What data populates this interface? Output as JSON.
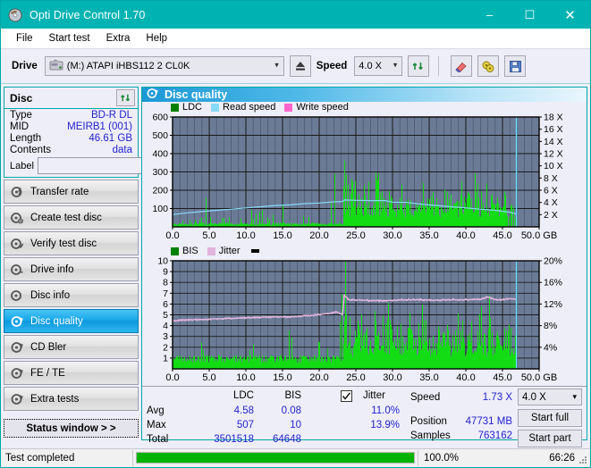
{
  "window": {
    "title": "Opti Drive Control 1.70",
    "icon": "disc-icon",
    "minimize": "–",
    "maximize": "☐",
    "close": "✕"
  },
  "menu": {
    "items": [
      {
        "label": "File",
        "accel": "F"
      },
      {
        "label": "Start test",
        "accel": "S"
      },
      {
        "label": "Extra",
        "accel": "x"
      },
      {
        "label": "Help",
        "accel": "H"
      }
    ]
  },
  "toolbar": {
    "drive_label": "Drive",
    "drive_value": "(M:)   ATAPI iHBS112  2 CL0K",
    "drive_icon": "drive-icon",
    "eject_icon": "eject-icon",
    "speed_label": "Speed",
    "speed_value": "4.0 X",
    "refresh_icon": "refresh-icon",
    "erase_icon": "eraser-icon",
    "bitsetting_icon": "bitsetting-icon",
    "save_icon": "save-icon"
  },
  "disc_panel": {
    "title": "Disc",
    "refresh_icon": "refresh-icon",
    "rows": [
      {
        "key": "Type",
        "value": "BD-R DL"
      },
      {
        "key": "MID",
        "value": "MEIRB1 (001)"
      },
      {
        "key": "Length",
        "value": "46.61 GB"
      },
      {
        "key": "Contents",
        "value": "data"
      }
    ],
    "label_key": "Label",
    "label_value": "",
    "label_placeholder": "",
    "label_icon": "disc-label-icon"
  },
  "sidebar": {
    "items": [
      {
        "label": "Transfer rate",
        "icon": "disc-transfer-icon",
        "active": false
      },
      {
        "label": "Create test disc",
        "icon": "disc-create-icon",
        "active": false
      },
      {
        "label": "Verify test disc",
        "icon": "disc-verify-icon",
        "active": false
      },
      {
        "label": "Drive info",
        "icon": "drive-info-icon",
        "active": false
      },
      {
        "label": "Disc info",
        "icon": "disc-info-icon",
        "active": false
      },
      {
        "label": "Disc quality",
        "icon": "disc-quality-icon",
        "active": true
      },
      {
        "label": "CD Bler",
        "icon": "cd-bler-icon",
        "active": false
      },
      {
        "label": "FE / TE",
        "icon": "fe-te-icon",
        "active": false
      },
      {
        "label": "Extra tests",
        "icon": "extra-tests-icon",
        "active": false
      }
    ],
    "status_window_button": "Status window > >"
  },
  "main": {
    "title": "Disc quality",
    "title_icon": "disc-quality-icon"
  },
  "stats": {
    "columns": [
      "LDC",
      "BIS"
    ],
    "jitter_label": "Jitter",
    "jitter_checked": true,
    "rows": [
      {
        "name": "Avg",
        "ldc": "4.58",
        "bis": "0.08",
        "jitter": "11.0%"
      },
      {
        "name": "Max",
        "ldc": "507",
        "bis": "10",
        "jitter": "13.9%"
      },
      {
        "name": "Total",
        "ldc": "3501518",
        "bis": "64648",
        "jitter": ""
      }
    ],
    "speed_label": "Speed",
    "speed_value": "1.73 X",
    "position_label": "Position",
    "position_value": "47731 MB",
    "samples_label": "Samples",
    "samples_value": "763162",
    "speed_select_value": "4.0 X",
    "start_full_label": "Start full",
    "start_part_label": "Start part"
  },
  "statusbar": {
    "text": "Test completed",
    "percent_label": "100.0%",
    "percent_value": 100,
    "time": "66:26",
    "bar_color": "#00b300"
  },
  "colors": {
    "accent": "#00b3b3",
    "plot_bg": "#6b7b96",
    "ldc_green": "#14dc14",
    "read_speed": "#87d9f5",
    "write_speed": "#ff66cc",
    "jitter_pink": "#e0b4dc",
    "value_blue": "#2222cc",
    "highlight_blue": "#19a8e8"
  },
  "chart_data": [
    {
      "type": "bar",
      "id": "ldc-chart",
      "title": "Disc quality",
      "xlabel": "GB",
      "ylabel": "LDC",
      "xlim": [
        0,
        50
      ],
      "ylim": [
        0,
        600
      ],
      "y2lim": [
        0,
        18
      ],
      "y2label": "X",
      "grid": true,
      "legend_position": "top-left",
      "legend": [
        {
          "name": "LDC",
          "color": "#008000",
          "type": "bar"
        },
        {
          "name": "Read speed",
          "color": "#87d9f5",
          "type": "line"
        },
        {
          "name": "Write speed",
          "color": "#ff66cc",
          "type": "line"
        }
      ],
      "xticks": [
        "0.0",
        "5.0",
        "10.0",
        "15.0",
        "20.0",
        "25.0",
        "30.0",
        "35.0",
        "40.0",
        "45.0",
        "50.0 GB"
      ],
      "yticks": [
        100,
        200,
        300,
        400,
        500,
        600
      ],
      "y2ticks": [
        "2 X",
        "4 X",
        "6 X",
        "8 X",
        "10 X",
        "12 X",
        "14 X",
        "16 X",
        "18 X"
      ],
      "data_end_gb": 46.9,
      "series": [
        {
          "name": "LDC",
          "color": "#14dc14",
          "type": "bar",
          "note": "Dense green error-count spikes; low baseline (<60) from 0-22 GB with occasional spikes to 150-290, dense noisy band 23-47 GB averaging 120-300 with peaks to 507.",
          "x": [
            0.1,
            0.3,
            0.8,
            1.4,
            2.0,
            2.6,
            3.2,
            3.9,
            4.6,
            4.8,
            5.4,
            6.1,
            6.8,
            7.4,
            8.1,
            8.8,
            9.4,
            10.1,
            10.8,
            11.4,
            12.1,
            12.8,
            13.4,
            14.1,
            14.5,
            14.9,
            15.4,
            16.0,
            16.6,
            17.2,
            17.8,
            18.4,
            19.0,
            19.6,
            20.2,
            20.8,
            21.4,
            22.0,
            22.3,
            22.6,
            22.9,
            23.2,
            23.4,
            23.6,
            23.8,
            24.0,
            24.2,
            24.4,
            24.6,
            24.8,
            25.0,
            25.3,
            25.6,
            25.9,
            26.2,
            26.5,
            26.8,
            27.1,
            27.4,
            27.7,
            28.0,
            28.3,
            28.6,
            28.9,
            29.2,
            29.5,
            29.8,
            30.1,
            30.4,
            30.7,
            31.0,
            31.4,
            31.8,
            32.2,
            32.6,
            33.0,
            33.4,
            33.8,
            34.2,
            34.6,
            35.0,
            35.4,
            35.8,
            36.2,
            36.6,
            37.0,
            37.4,
            37.8,
            38.2,
            38.6,
            39.0,
            39.4,
            39.8,
            40.2,
            40.6,
            41.0,
            41.4,
            41.8,
            42.2,
            42.6,
            43.0,
            43.4,
            43.8,
            44.2,
            44.6,
            45.0,
            45.4,
            45.8,
            46.2,
            46.6,
            46.9
          ],
          "values": [
            290,
            60,
            40,
            35,
            45,
            55,
            40,
            50,
            210,
            70,
            55,
            40,
            45,
            50,
            60,
            55,
            45,
            60,
            85,
            70,
            160,
            60,
            55,
            65,
            195,
            110,
            90,
            75,
            70,
            160,
            80,
            90,
            65,
            130,
            140,
            70,
            95,
            415,
            120,
            230,
            95,
            180,
            505,
            280,
            290,
            250,
            330,
            270,
            240,
            210,
            260,
            175,
            230,
            250,
            195,
            190,
            265,
            230,
            190,
            285,
            370,
            265,
            200,
            210,
            240,
            180,
            160,
            150,
            140,
            130,
            200,
            280,
            170,
            150,
            135,
            145,
            125,
            140,
            330,
            180,
            155,
            225,
            145,
            165,
            135,
            180,
            250,
            200,
            165,
            150,
            190,
            230,
            180,
            200,
            150,
            260,
            330,
            170,
            195,
            145,
            290,
            175,
            150,
            165,
            130,
            175,
            200
          ]
        },
        {
          "name": "Read speed",
          "color": "#87d9f5",
          "type": "line",
          "note": "Read speed ramps from ~2.0X at 0 GB up to ~4.3X around 23-29 GB, then declines to ~2.1X at 46.9 GB; in LDC-axis units.",
          "x": [
            0,
            2,
            4,
            6,
            8,
            10,
            12,
            14,
            16,
            18,
            20,
            22,
            23.2,
            23.4,
            25,
            27,
            29,
            30,
            32,
            34,
            36,
            38,
            40,
            42,
            44,
            46,
            46.9
          ],
          "values_x_speed": [
            2.0,
            2.3,
            2.5,
            2.7,
            2.9,
            3.1,
            3.3,
            3.5,
            3.6,
            3.8,
            3.9,
            4.1,
            4.15,
            4.4,
            4.35,
            4.3,
            4.3,
            4.05,
            4.0,
            3.7,
            3.5,
            3.3,
            3.1,
            2.9,
            2.7,
            2.4,
            2.1
          ]
        }
      ],
      "cursor_line_gb": 46.9,
      "cursor_color": "#66e0ff"
    },
    {
      "type": "bar",
      "id": "bis-chart",
      "title": "",
      "xlabel": "GB",
      "ylabel": "BIS",
      "xlim": [
        0,
        50
      ],
      "ylim": [
        0,
        10
      ],
      "y2lim": [
        0,
        20
      ],
      "y2label": "%",
      "grid": true,
      "legend_position": "top-left",
      "legend": [
        {
          "name": "BIS",
          "color": "#008000",
          "type": "bar"
        },
        {
          "name": "Jitter",
          "color": "#e0b4dc",
          "type": "line"
        }
      ],
      "xticks": [
        "0.0",
        "5.0",
        "10.0",
        "15.0",
        "20.0",
        "25.0",
        "30.0",
        "35.0",
        "40.0",
        "45.0",
        "50.0 GB"
      ],
      "yticks": [
        1,
        2,
        3,
        4,
        5,
        6,
        7,
        8,
        9,
        10
      ],
      "y2ticks": [
        "4%",
        "8%",
        "12%",
        "16%",
        "20%"
      ],
      "data_end_gb": 46.9,
      "series": [
        {
          "name": "BIS",
          "color": "#14dc14",
          "type": "bar",
          "note": "Solid green fill up to ~1 across 0-23 GB with sparse spikes to 2-6; from 23-47 GB fill rises to ~2 with dense spikes 3-7 and maxima to 10.",
          "x": [
            0.1,
            0.5,
            1.2,
            2.0,
            2.8,
            3.6,
            4.4,
            4.7,
            5.4,
            6.2,
            7.0,
            7.8,
            8.6,
            9.4,
            10.2,
            11.0,
            11.8,
            12.6,
            13.4,
            14.2,
            15.0,
            15.8,
            16.6,
            17.4,
            18.2,
            19.0,
            19.8,
            20.6,
            21.4,
            22.2,
            22.4,
            22.8,
            23.1,
            23.3,
            23.5,
            23.8,
            24.0,
            24.2,
            24.4,
            24.6,
            24.8,
            25.2,
            25.6,
            26.0,
            26.4,
            26.8,
            27.2,
            27.6,
            28.0,
            28.4,
            28.8,
            29.2,
            29.6,
            30.0,
            30.6,
            31.2,
            31.8,
            32.4,
            33.0,
            33.6,
            34.2,
            34.8,
            35.4,
            36.0,
            36.6,
            37.2,
            37.8,
            38.4,
            39.0,
            39.6,
            40.2,
            40.8,
            41.4,
            42.0,
            42.6,
            43.2,
            43.8,
            44.4,
            45.0,
            45.6,
            46.2,
            46.8
          ],
          "values": [
            6,
            1,
            1,
            1,
            1,
            3,
            1,
            5,
            1,
            1,
            1,
            1,
            1,
            1,
            1,
            3,
            1,
            1,
            1,
            1,
            1,
            5,
            1,
            2,
            2,
            2,
            2,
            5,
            2,
            8,
            2,
            5,
            7,
            4,
            9,
            10,
            5,
            6,
            4,
            5,
            4,
            5,
            6,
            4,
            5,
            3,
            4,
            5,
            3,
            6,
            4,
            6,
            5,
            3,
            4,
            4,
            3,
            5,
            3,
            4,
            6,
            3,
            4,
            5,
            3,
            4,
            6,
            3,
            5,
            4,
            3,
            5,
            4,
            6,
            3,
            7,
            4,
            3,
            5,
            4,
            6,
            4
          ]
        },
        {
          "name": "Jitter",
          "color": "#e0b4dc",
          "type": "line",
          "note": "Jitter trace, in BIS-axis units: starts ~4.4 (8.8%), creeps to ~5.2 (10.4%) by 22 GB, steps up sharply to ~6.4 (12.8%) at 23.3 GB and stays ~6.3-6.5 through 46.9 GB.",
          "x": [
            0,
            1,
            3,
            5,
            7,
            9,
            11,
            13,
            15,
            17,
            19,
            21,
            22.5,
            23.2,
            23.4,
            24,
            26,
            28,
            30,
            32,
            34,
            36,
            38,
            40,
            42,
            43,
            44,
            45,
            46,
            46.9
          ],
          "values": [
            4.4,
            4.5,
            4.55,
            4.6,
            4.65,
            4.7,
            4.75,
            4.8,
            4.8,
            4.85,
            4.95,
            5.1,
            5.25,
            5.0,
            6.85,
            6.4,
            6.35,
            6.3,
            6.35,
            6.4,
            6.4,
            6.35,
            6.4,
            6.4,
            6.45,
            6.65,
            6.4,
            6.4,
            6.5,
            6.45
          ],
          "values_pct": [
            8.8,
            9.0,
            9.1,
            9.2,
            9.3,
            9.4,
            9.5,
            9.6,
            9.6,
            9.7,
            9.9,
            10.2,
            10.5,
            10.0,
            13.7,
            12.8,
            12.7,
            12.6,
            12.7,
            12.8,
            12.8,
            12.7,
            12.8,
            12.8,
            12.9,
            13.3,
            12.8,
            12.8,
            13.0,
            12.9
          ]
        }
      ],
      "cursor_line_gb": 46.9,
      "cursor_color": "#66e0ff"
    }
  ]
}
